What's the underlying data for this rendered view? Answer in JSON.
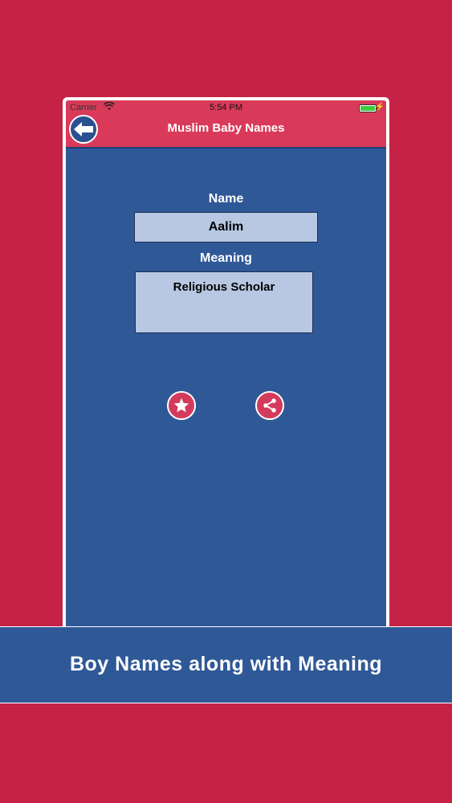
{
  "status_bar": {
    "carrier": "Carrier",
    "time": "5:54 PM"
  },
  "nav": {
    "title": "Muslim Baby Names",
    "back_icon": "arrow-left-icon"
  },
  "detail": {
    "name_label": "Name",
    "name_value": "Aalim",
    "meaning_label": "Meaning",
    "meaning_value": "Religious Scholar"
  },
  "actions": {
    "favorite_icon": "star-icon",
    "share_icon": "share-icon"
  },
  "banner": {
    "text": "Boy Names along with Meaning"
  },
  "colors": {
    "background": "#c52245",
    "screen": "#2f5897",
    "navbar": "#d93a5a",
    "field": "#b8c8e3",
    "button": "#d33b5c"
  }
}
